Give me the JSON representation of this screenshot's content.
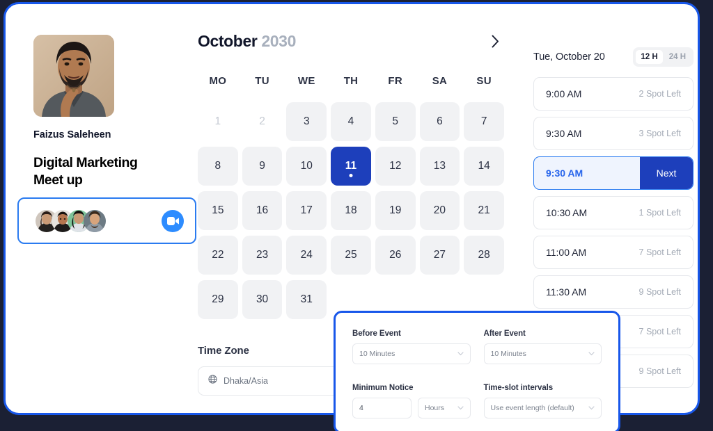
{
  "theme": {
    "page_bg": "#1b2034",
    "card_border": "#1857ea",
    "accent_blue": "#1d3fbb",
    "popup_border": "#2a7bf0",
    "zoom_blue": "#2d8cff",
    "day_bg": "#f1f2f4"
  },
  "profile": {
    "name": "Faizus Saleheen",
    "event_title": "Digital Marketing Meet up"
  },
  "calendar": {
    "month": "October",
    "year": "2030",
    "next_month_icon": "chevron-right-icon",
    "weekdays": [
      "MO",
      "TU",
      "WE",
      "TH",
      "FR",
      "SA",
      "SU"
    ],
    "days": [
      {
        "label": "1",
        "state": "muted"
      },
      {
        "label": "2",
        "state": "muted"
      },
      {
        "label": "3",
        "state": "normal"
      },
      {
        "label": "4",
        "state": "normal"
      },
      {
        "label": "5",
        "state": "normal"
      },
      {
        "label": "6",
        "state": "normal"
      },
      {
        "label": "7",
        "state": "normal"
      },
      {
        "label": "8",
        "state": "normal"
      },
      {
        "label": "9",
        "state": "normal"
      },
      {
        "label": "10",
        "state": "normal"
      },
      {
        "label": "11",
        "state": "selected"
      },
      {
        "label": "12",
        "state": "normal"
      },
      {
        "label": "13",
        "state": "normal"
      },
      {
        "label": "14",
        "state": "normal"
      },
      {
        "label": "15",
        "state": "normal"
      },
      {
        "label": "16",
        "state": "normal"
      },
      {
        "label": "17",
        "state": "normal"
      },
      {
        "label": "18",
        "state": "normal"
      },
      {
        "label": "19",
        "state": "normal"
      },
      {
        "label": "20",
        "state": "normal"
      },
      {
        "label": "21",
        "state": "normal"
      },
      {
        "label": "22",
        "state": "normal"
      },
      {
        "label": "23",
        "state": "normal"
      },
      {
        "label": "24",
        "state": "normal"
      },
      {
        "label": "25",
        "state": "normal"
      },
      {
        "label": "26",
        "state": "normal"
      },
      {
        "label": "27",
        "state": "normal"
      },
      {
        "label": "28",
        "state": "normal"
      },
      {
        "label": "29",
        "state": "normal"
      },
      {
        "label": "30",
        "state": "normal"
      },
      {
        "label": "31",
        "state": "normal"
      }
    ]
  },
  "attendees_popup": {
    "avatar_count": 4,
    "call_icon": "video-camera-icon"
  },
  "timezone": {
    "label": "Time Zone",
    "icon": "globe-icon",
    "value": "Dhaka/Asia"
  },
  "slots_panel": {
    "date": "Tue, October 20",
    "hour_format": {
      "options": [
        "12 H",
        "24 H"
      ],
      "selected": "12 H"
    },
    "slots": [
      {
        "time": "9:00 AM",
        "spots": "2 Spot Left",
        "selected": false
      },
      {
        "time": "9:30 AM",
        "spots": "3 Spot Left",
        "selected": false
      },
      {
        "time": "9:30 AM",
        "spots": "",
        "selected": true,
        "action": "Next"
      },
      {
        "time": "10:30 AM",
        "spots": "1 Spot Left",
        "selected": false
      },
      {
        "time": "11:00 AM",
        "spots": "7 Spot Left",
        "selected": false
      },
      {
        "time": "11:30 AM",
        "spots": "9 Spot Left",
        "selected": false
      },
      {
        "time": "",
        "spots": "7 Spot Left",
        "selected": false
      },
      {
        "time": "",
        "spots": "9 Spot Left",
        "selected": false
      }
    ]
  },
  "settings_popup": {
    "before_event": {
      "label": "Before Event",
      "value": "10 Minutes",
      "icon": "chevron-down-icon"
    },
    "after_event": {
      "label": "After Event",
      "value": "10 Minutes",
      "icon": "chevron-down-icon"
    },
    "minimum_notice": {
      "label": "Minimum Notice",
      "amount": "4",
      "unit": "Hours",
      "icon": "chevron-down-icon"
    },
    "timeslot_intervals": {
      "label": "Time-slot intervals",
      "value": "Use event length (default)",
      "icon": "chevron-down-icon"
    }
  }
}
